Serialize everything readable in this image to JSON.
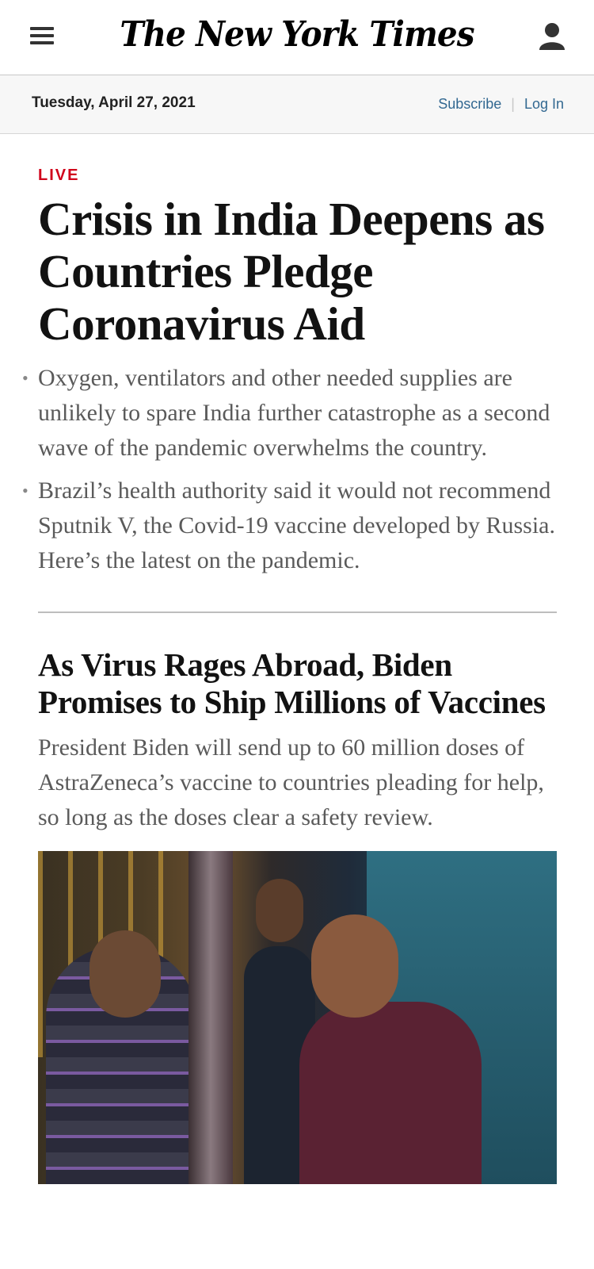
{
  "header": {
    "logo_text": "The New York Times",
    "menu_icon": "hamburger-menu-icon",
    "user_icon": "user-account-icon"
  },
  "datebar": {
    "date": "Tuesday, April 27, 2021",
    "subscribe_label": "Subscribe",
    "separator": "|",
    "login_label": "Log In",
    "link_color": "#326891"
  },
  "lead_story": {
    "label": "LIVE",
    "label_color": "#d0021b",
    "headline": "Crisis in India Deepens as Countries Pledge Coronavirus Aid",
    "bullets": [
      "Oxygen, ventilators and other needed supplies are unlikely to spare India further catastrophe as a second wave of the pandemic overwhelms the country.",
      "Brazil’s health authority said it would not recommend Sputnik V, the Covid-19 vaccine developed by Russia. Here’s the latest on the pandemic."
    ]
  },
  "second_story": {
    "headline": "As Virus Rages Abroad, Biden Promises to Ship Millions of Vaccines",
    "summary": "President Biden will send up to 60 million doses of AstraZeneca’s vaccine to countries pleading for help, so long as the doses clear a safety review."
  }
}
